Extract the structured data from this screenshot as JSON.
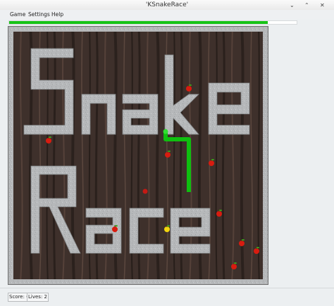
{
  "window": {
    "title": "'KSnakeRace'",
    "minimize_glyph": "⌄",
    "maximize_glyph": "⌃",
    "close_glyph": "✕"
  },
  "menu": [
    {
      "label": "Game"
    },
    {
      "label": "Settings"
    },
    {
      "label": "Help"
    }
  ],
  "progress": {
    "fraction": 0.9,
    "color": "#16c416"
  },
  "status": {
    "score": "Score: 0",
    "lives": "Lives: 2"
  },
  "board": {
    "wall_color": "#b6b8ba",
    "wood_color": "#3d2f2a",
    "snake_color": "#0fbf0f"
  },
  "icons": {
    "snake": "snake-icon",
    "apple": "apple-icon",
    "ball": "ball-icon",
    "golden_apple": "golden-apple-icon"
  }
}
